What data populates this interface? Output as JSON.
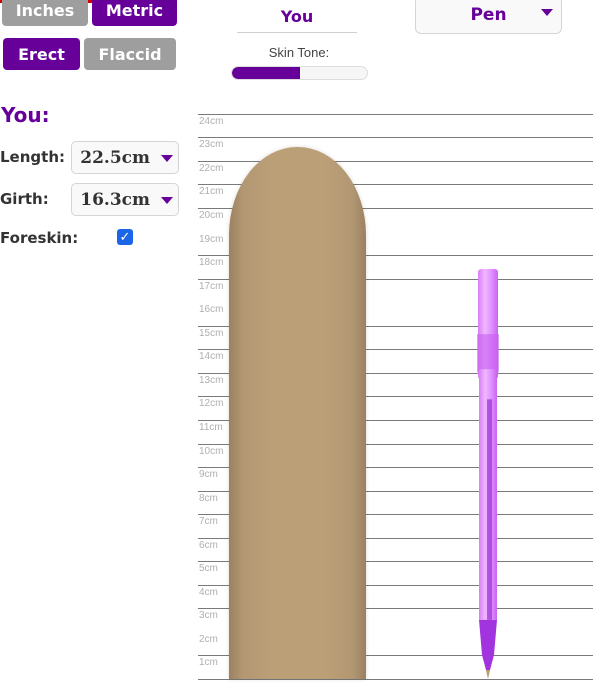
{
  "units": {
    "inches_label": "Inches",
    "metric_label": "Metric",
    "selected": "Metric"
  },
  "state": {
    "erect_label": "Erect",
    "flaccid_label": "Flaccid",
    "selected": "Erect"
  },
  "tabs": {
    "you_label": "You"
  },
  "skin_tone": {
    "label": "Skin Tone:",
    "value_fraction": 0.5,
    "color": "#660099"
  },
  "comparison": {
    "selected": "Pen"
  },
  "you_panel": {
    "title": "You:",
    "length_label": "Length:",
    "length_value": "22.5cm",
    "girth_label": "Girth:",
    "girth_value": "16.3cm",
    "foreskin_label": "Foreskin:",
    "foreskin_checked": true
  },
  "colors": {
    "accent": "#660099",
    "skin": "#bb9f77",
    "pen": "#cc66ff",
    "inactive": "#9e9e9e"
  },
  "chart_data": {
    "type": "scale-comparison",
    "unit": "cm",
    "tick_labels": [
      "1cm",
      "2cm",
      "3cm",
      "4cm",
      "5cm",
      "6cm",
      "7cm",
      "8cm",
      "9cm",
      "10cm",
      "11cm",
      "12cm",
      "13cm",
      "14cm",
      "15cm",
      "16cm",
      "17cm",
      "18cm",
      "19cm",
      "20cm",
      "21cm",
      "22cm",
      "23cm",
      "24cm"
    ],
    "gridlines_cm": [
      0,
      1,
      3,
      4,
      5,
      6,
      7,
      8,
      9,
      10,
      11,
      12,
      13,
      14,
      15,
      17,
      18,
      20,
      21,
      22,
      23,
      24
    ],
    "range_cm": [
      0,
      24
    ],
    "items": [
      {
        "name": "You",
        "length_cm": 22.5
      },
      {
        "name": "Pen",
        "length_cm": 17.4
      }
    ]
  }
}
